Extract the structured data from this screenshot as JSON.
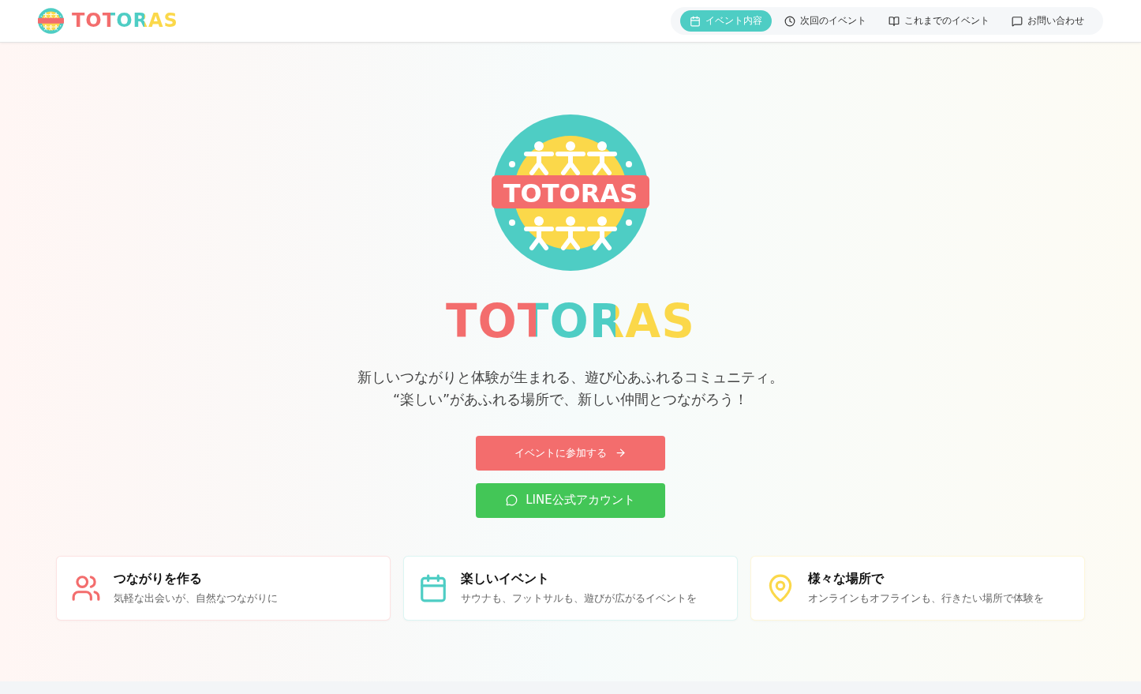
{
  "header": {
    "brand": "TOTORAS"
  },
  "nav": [
    {
      "label": "イベント内容",
      "kind": "calendar",
      "selected": true
    },
    {
      "label": "次回のイベント",
      "kind": "clock",
      "selected": false
    },
    {
      "label": "これまでのイベント",
      "kind": "book",
      "selected": false
    },
    {
      "label": "お問い合わせ",
      "kind": "message",
      "selected": false
    }
  ],
  "hero": {
    "logo_badge": "TOTORAS",
    "title": "TOTORAS",
    "tagline": [
      "新しいつながりと体験が生まれる、遊び心あふれるコミュニティ。",
      "“楽しい”があふれる場所で、新しい仲間とつながろう！"
    ],
    "buttons": [
      {
        "kind": "primary",
        "label": "イベントに参加する"
      },
      {
        "kind": "line",
        "label": "LINE公式アカウント"
      }
    ]
  },
  "features": [
    {
      "kind": "users",
      "color": "#f36d6d",
      "title": "つながりを作る",
      "text": "気軽な出会いが、自然なつながりに"
    },
    {
      "kind": "calendar",
      "color": "#4ecdc4",
      "title": "楽しいイベント",
      "text": "サウナも、フットサルも、遊びが広がるイベントを"
    },
    {
      "kind": "pin",
      "color": "#fbd84a",
      "title": "様々な場所で",
      "text": "オンラインもオフラインも、行きたい場所で体験を"
    }
  ]
}
